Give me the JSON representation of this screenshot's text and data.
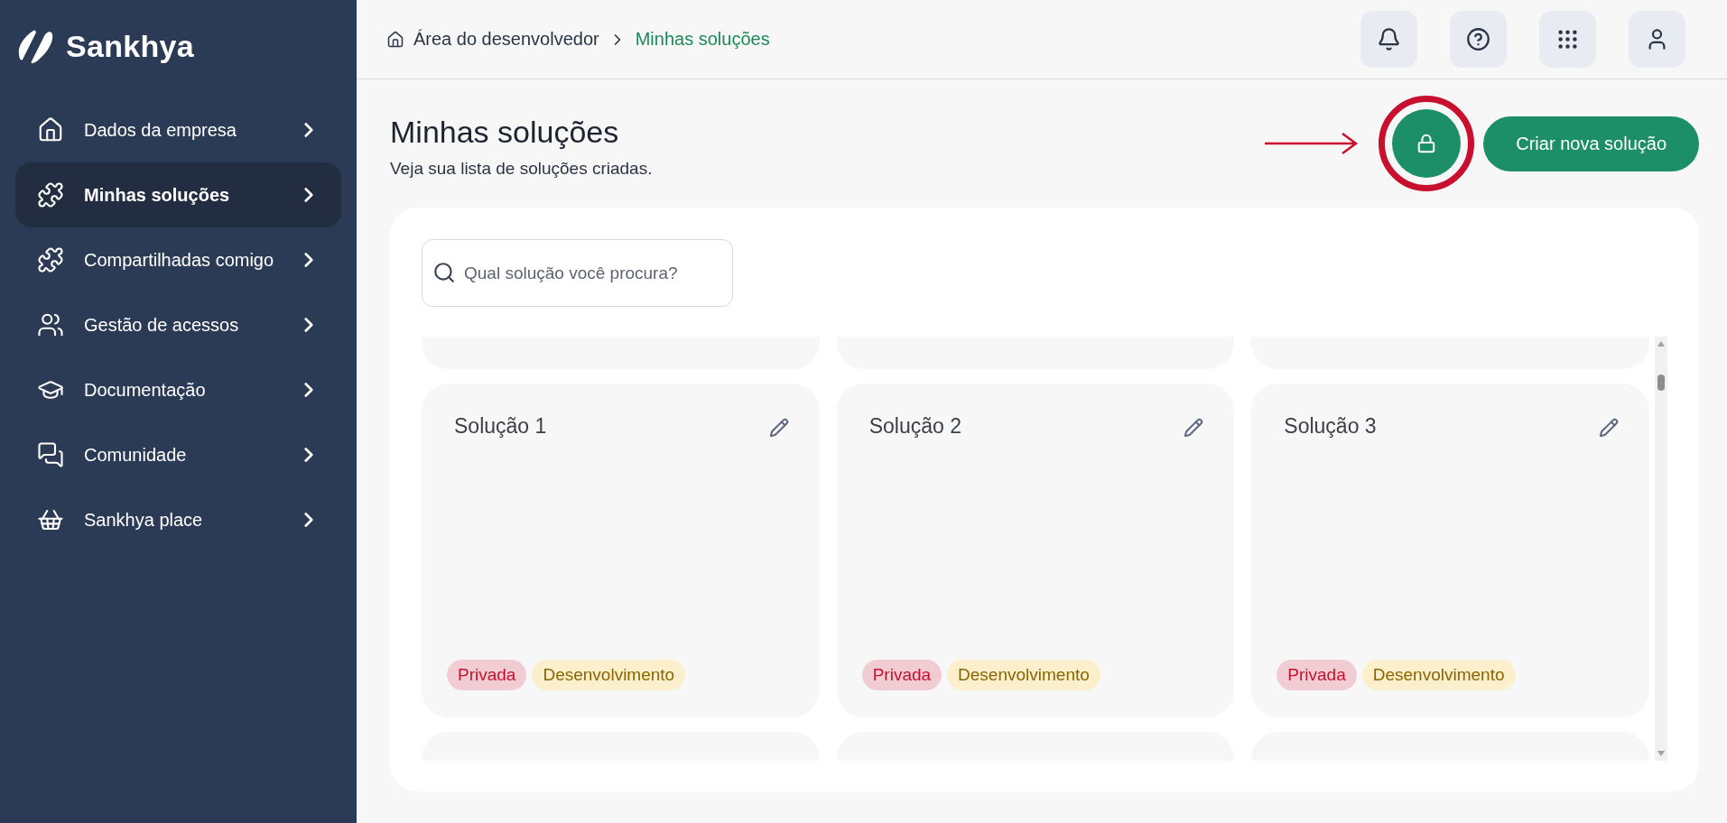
{
  "brand": {
    "name": "Sankhya"
  },
  "sidebar": {
    "items": [
      {
        "label": "Dados da empresa",
        "kind": "home",
        "selected": false
      },
      {
        "label": "Minhas soluções",
        "kind": "puzzle",
        "selected": true
      },
      {
        "label": "Compartilhadas comigo",
        "kind": "puzzle",
        "selected": false
      },
      {
        "label": "Gestão de acessos",
        "kind": "users",
        "selected": false
      },
      {
        "label": "Documentação",
        "kind": "graduation",
        "selected": false
      },
      {
        "label": "Comunidade",
        "kind": "chat",
        "selected": false
      },
      {
        "label": "Sankhya place",
        "kind": "basket",
        "selected": false
      }
    ]
  },
  "breadcrumb": [
    {
      "label": "Área do desenvolvedor",
      "current": false
    },
    {
      "label": "Minhas soluções",
      "current": true
    }
  ],
  "header_buttons": [
    {
      "kind": "bell"
    },
    {
      "kind": "help"
    },
    {
      "kind": "apps"
    },
    {
      "kind": "user"
    }
  ],
  "page": {
    "title": "Minhas soluções",
    "subtitle": "Veja sua lista de soluções criadas.",
    "create_button": "Criar nova solução"
  },
  "search": {
    "placeholder": "Qual solução você procura?"
  },
  "solutions": [
    {
      "title": "Solução 1",
      "tags": [
        {
          "label": "Privada",
          "kind": "visibility"
        },
        {
          "label": "Desenvolvimento",
          "kind": "stage"
        }
      ]
    },
    {
      "title": "Solução 2",
      "tags": [
        {
          "label": "Privada",
          "kind": "visibility"
        },
        {
          "label": "Desenvolvimento",
          "kind": "stage"
        }
      ]
    },
    {
      "title": "Solução 3",
      "tags": [
        {
          "label": "Privada",
          "kind": "visibility"
        },
        {
          "label": "Desenvolvimento",
          "kind": "stage"
        }
      ]
    }
  ]
}
